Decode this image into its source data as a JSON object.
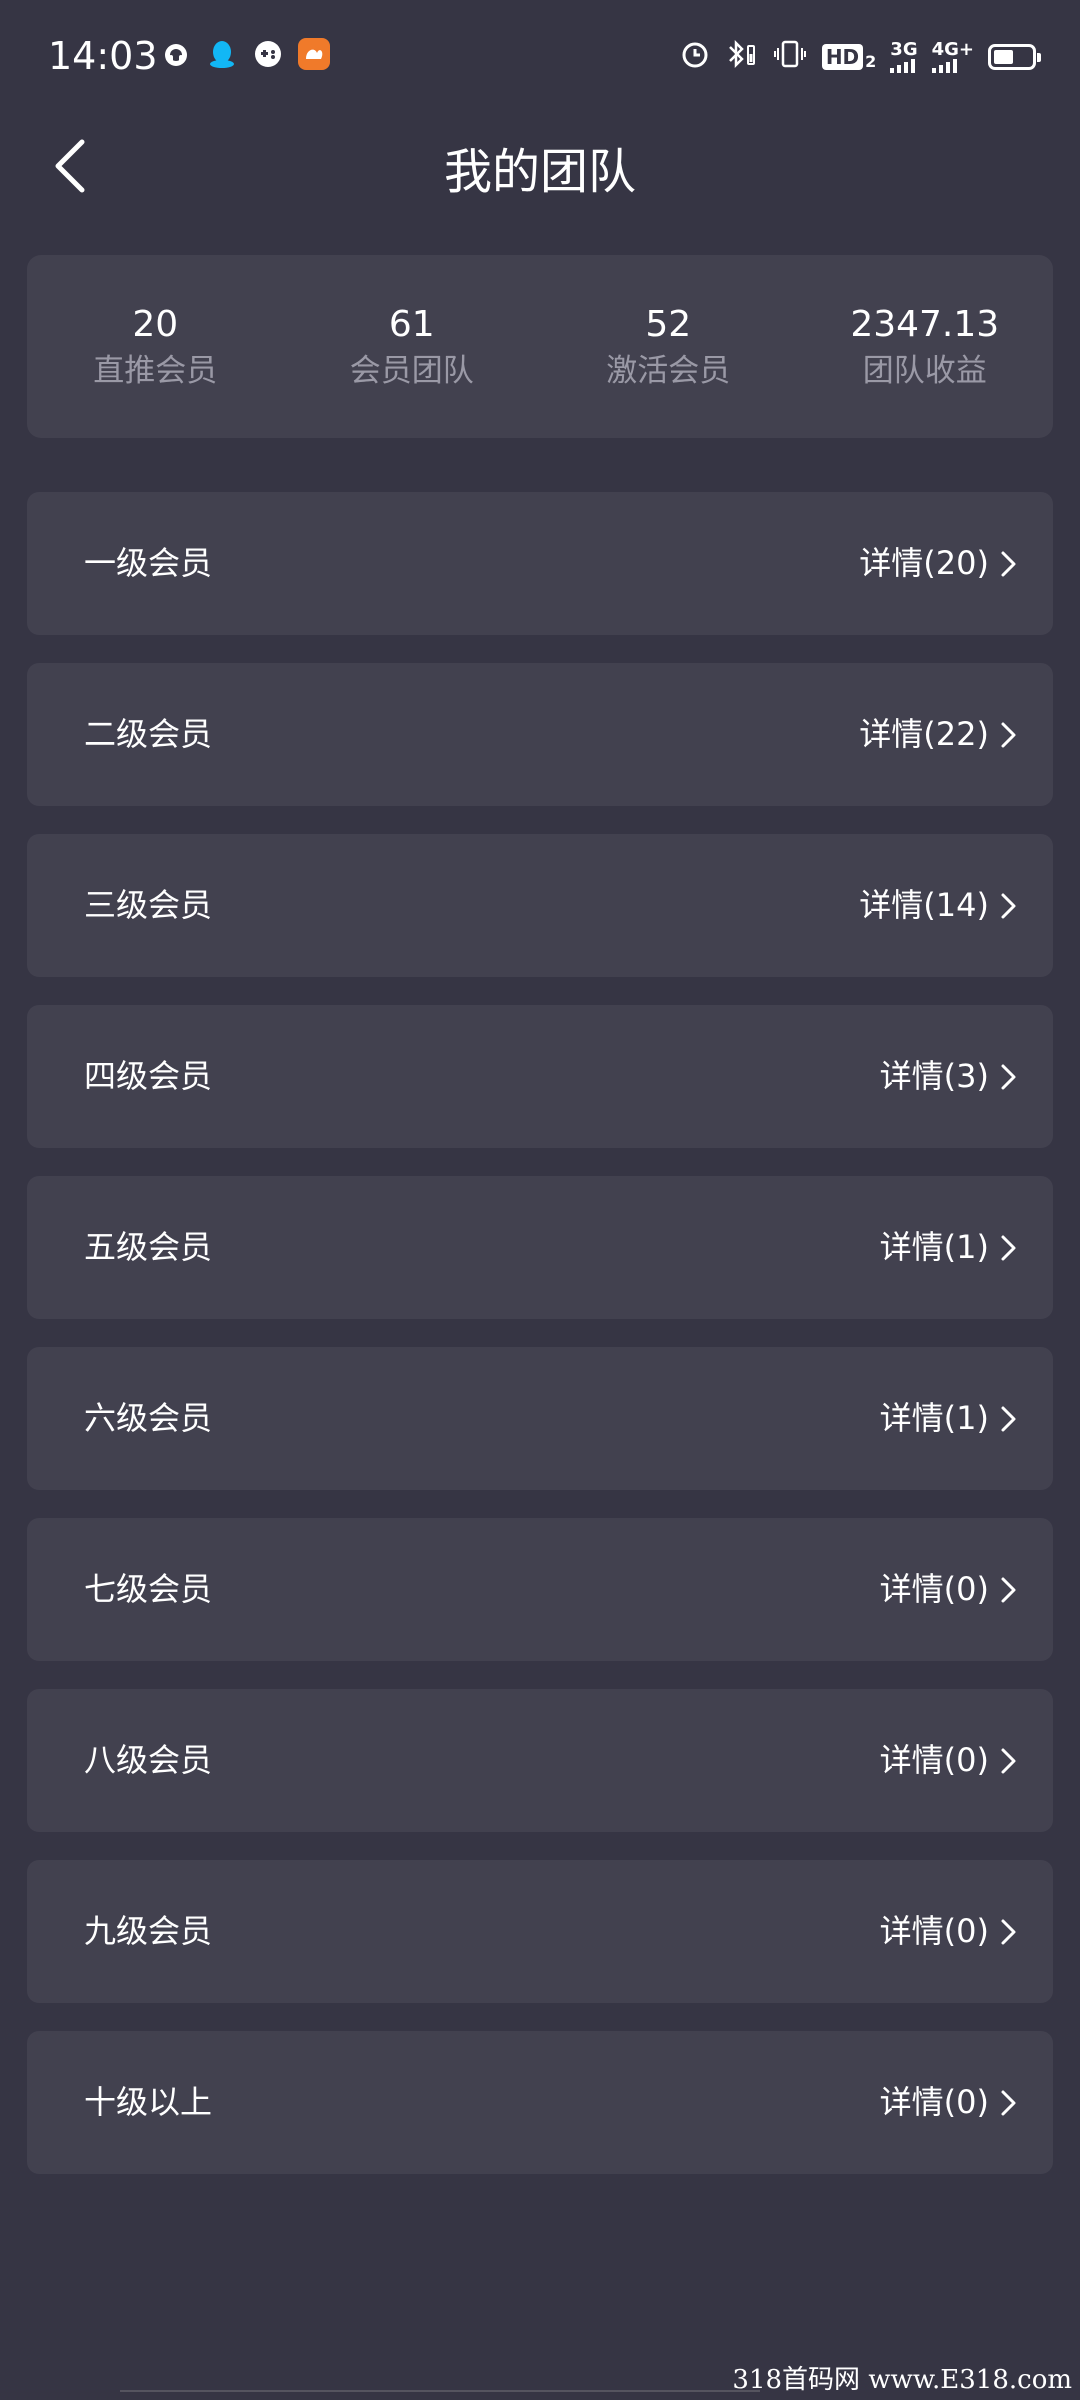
{
  "status_bar": {
    "time": "14:03",
    "network_hd": "HD",
    "network_hd_sub": "2",
    "network_3g": "3G",
    "network_4g": "4G+"
  },
  "header": {
    "title": "我的团队"
  },
  "stats": [
    {
      "value": "20",
      "label": "直推会员"
    },
    {
      "value": "61",
      "label": "会员团队"
    },
    {
      "value": "52",
      "label": "激活会员"
    },
    {
      "value": "2347.13",
      "label": "团队收益"
    }
  ],
  "levels": [
    {
      "name": "一级会员",
      "detail": "详情(20)"
    },
    {
      "name": "二级会员",
      "detail": "详情(22)"
    },
    {
      "name": "三级会员",
      "detail": "详情(14)"
    },
    {
      "name": "四级会员",
      "detail": "详情(3)"
    },
    {
      "name": "五级会员",
      "detail": "详情(1)"
    },
    {
      "name": "六级会员",
      "detail": "详情(1)"
    },
    {
      "name": "七级会员",
      "detail": "详情(0)"
    },
    {
      "name": "八级会员",
      "detail": "详情(0)"
    },
    {
      "name": "九级会员",
      "detail": "详情(0)"
    },
    {
      "name": "十级以上",
      "detail": "详情(0)"
    }
  ],
  "watermark": "318首码网 www.E318.com",
  "colors": {
    "background": "#363544",
    "card": "#42414f",
    "label_muted": "#9a99a6"
  }
}
